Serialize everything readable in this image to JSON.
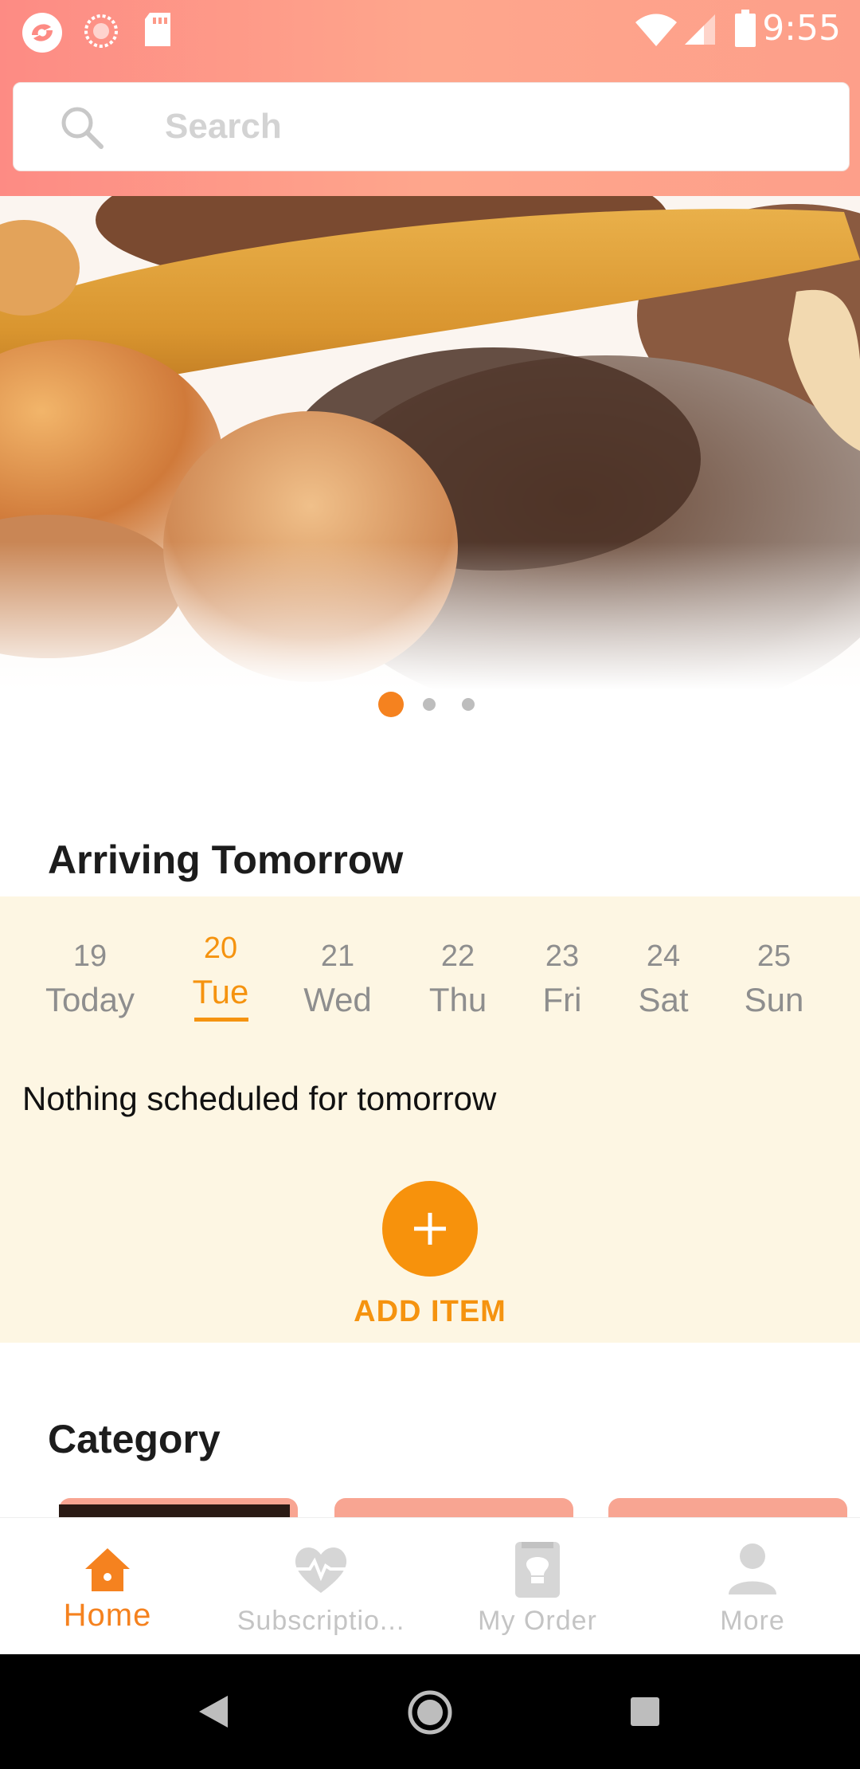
{
  "status_bar": {
    "time": "9:55",
    "icons": [
      "app-logo-icon",
      "sync-icon",
      "sd-card-icon",
      "wifi-icon",
      "signal-icon",
      "battery-icon"
    ]
  },
  "search": {
    "placeholder": "Search",
    "value": ""
  },
  "banner": {
    "slide_count": 3,
    "active_slide": 0
  },
  "arriving": {
    "title": "Arriving Tomorrow",
    "days": [
      {
        "num": "19",
        "name": "Today"
      },
      {
        "num": "20",
        "name": "Tue"
      },
      {
        "num": "21",
        "name": "Wed"
      },
      {
        "num": "22",
        "name": "Thu"
      },
      {
        "num": "23",
        "name": "Fri"
      },
      {
        "num": "24",
        "name": "Sat"
      },
      {
        "num": "25",
        "name": "Sun"
      }
    ],
    "selected_day": "20",
    "empty_message": "Nothing scheduled for tomorrow",
    "add_label": "ADD ITEM"
  },
  "category": {
    "title": "Category"
  },
  "bottom_nav": {
    "items": [
      {
        "label": "Home",
        "icon": "home-icon"
      },
      {
        "label": "Subscriptio...",
        "icon": "heart-pulse-icon"
      },
      {
        "label": "My Order",
        "icon": "order-icon"
      },
      {
        "label": "More",
        "icon": "user-icon"
      }
    ],
    "active": "Home"
  },
  "colors": {
    "accent": "#f5930f",
    "header_gradient_start": "#fd8b84",
    "header_gradient_end": "#fea68c",
    "schedule_background": "#fdf6e3",
    "inactive_nav": "#c4c4c4"
  }
}
